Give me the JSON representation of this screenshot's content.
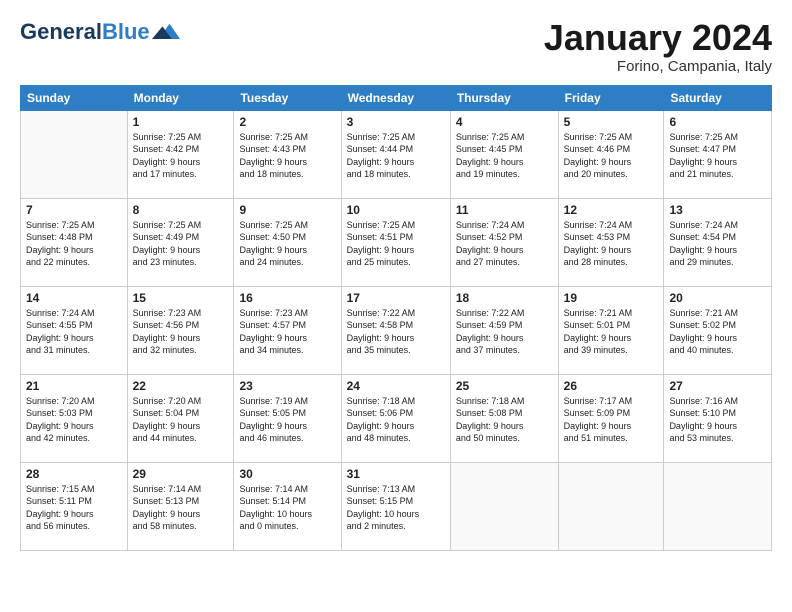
{
  "header": {
    "logo_line1": "General",
    "logo_line2": "Blue",
    "month_title": "January 2024",
    "location": "Forino, Campania, Italy"
  },
  "days_of_week": [
    "Sunday",
    "Monday",
    "Tuesday",
    "Wednesday",
    "Thursday",
    "Friday",
    "Saturday"
  ],
  "weeks": [
    [
      {
        "day": "",
        "info": ""
      },
      {
        "day": "1",
        "info": "Sunrise: 7:25 AM\nSunset: 4:42 PM\nDaylight: 9 hours\nand 17 minutes."
      },
      {
        "day": "2",
        "info": "Sunrise: 7:25 AM\nSunset: 4:43 PM\nDaylight: 9 hours\nand 18 minutes."
      },
      {
        "day": "3",
        "info": "Sunrise: 7:25 AM\nSunset: 4:44 PM\nDaylight: 9 hours\nand 18 minutes."
      },
      {
        "day": "4",
        "info": "Sunrise: 7:25 AM\nSunset: 4:45 PM\nDaylight: 9 hours\nand 19 minutes."
      },
      {
        "day": "5",
        "info": "Sunrise: 7:25 AM\nSunset: 4:46 PM\nDaylight: 9 hours\nand 20 minutes."
      },
      {
        "day": "6",
        "info": "Sunrise: 7:25 AM\nSunset: 4:47 PM\nDaylight: 9 hours\nand 21 minutes."
      }
    ],
    [
      {
        "day": "7",
        "info": "Sunrise: 7:25 AM\nSunset: 4:48 PM\nDaylight: 9 hours\nand 22 minutes."
      },
      {
        "day": "8",
        "info": "Sunrise: 7:25 AM\nSunset: 4:49 PM\nDaylight: 9 hours\nand 23 minutes."
      },
      {
        "day": "9",
        "info": "Sunrise: 7:25 AM\nSunset: 4:50 PM\nDaylight: 9 hours\nand 24 minutes."
      },
      {
        "day": "10",
        "info": "Sunrise: 7:25 AM\nSunset: 4:51 PM\nDaylight: 9 hours\nand 25 minutes."
      },
      {
        "day": "11",
        "info": "Sunrise: 7:24 AM\nSunset: 4:52 PM\nDaylight: 9 hours\nand 27 minutes."
      },
      {
        "day": "12",
        "info": "Sunrise: 7:24 AM\nSunset: 4:53 PM\nDaylight: 9 hours\nand 28 minutes."
      },
      {
        "day": "13",
        "info": "Sunrise: 7:24 AM\nSunset: 4:54 PM\nDaylight: 9 hours\nand 29 minutes."
      }
    ],
    [
      {
        "day": "14",
        "info": "Sunrise: 7:24 AM\nSunset: 4:55 PM\nDaylight: 9 hours\nand 31 minutes."
      },
      {
        "day": "15",
        "info": "Sunrise: 7:23 AM\nSunset: 4:56 PM\nDaylight: 9 hours\nand 32 minutes."
      },
      {
        "day": "16",
        "info": "Sunrise: 7:23 AM\nSunset: 4:57 PM\nDaylight: 9 hours\nand 34 minutes."
      },
      {
        "day": "17",
        "info": "Sunrise: 7:22 AM\nSunset: 4:58 PM\nDaylight: 9 hours\nand 35 minutes."
      },
      {
        "day": "18",
        "info": "Sunrise: 7:22 AM\nSunset: 4:59 PM\nDaylight: 9 hours\nand 37 minutes."
      },
      {
        "day": "19",
        "info": "Sunrise: 7:21 AM\nSunset: 5:01 PM\nDaylight: 9 hours\nand 39 minutes."
      },
      {
        "day": "20",
        "info": "Sunrise: 7:21 AM\nSunset: 5:02 PM\nDaylight: 9 hours\nand 40 minutes."
      }
    ],
    [
      {
        "day": "21",
        "info": "Sunrise: 7:20 AM\nSunset: 5:03 PM\nDaylight: 9 hours\nand 42 minutes."
      },
      {
        "day": "22",
        "info": "Sunrise: 7:20 AM\nSunset: 5:04 PM\nDaylight: 9 hours\nand 44 minutes."
      },
      {
        "day": "23",
        "info": "Sunrise: 7:19 AM\nSunset: 5:05 PM\nDaylight: 9 hours\nand 46 minutes."
      },
      {
        "day": "24",
        "info": "Sunrise: 7:18 AM\nSunset: 5:06 PM\nDaylight: 9 hours\nand 48 minutes."
      },
      {
        "day": "25",
        "info": "Sunrise: 7:18 AM\nSunset: 5:08 PM\nDaylight: 9 hours\nand 50 minutes."
      },
      {
        "day": "26",
        "info": "Sunrise: 7:17 AM\nSunset: 5:09 PM\nDaylight: 9 hours\nand 51 minutes."
      },
      {
        "day": "27",
        "info": "Sunrise: 7:16 AM\nSunset: 5:10 PM\nDaylight: 9 hours\nand 53 minutes."
      }
    ],
    [
      {
        "day": "28",
        "info": "Sunrise: 7:15 AM\nSunset: 5:11 PM\nDaylight: 9 hours\nand 56 minutes."
      },
      {
        "day": "29",
        "info": "Sunrise: 7:14 AM\nSunset: 5:13 PM\nDaylight: 9 hours\nand 58 minutes."
      },
      {
        "day": "30",
        "info": "Sunrise: 7:14 AM\nSunset: 5:14 PM\nDaylight: 10 hours\nand 0 minutes."
      },
      {
        "day": "31",
        "info": "Sunrise: 7:13 AM\nSunset: 5:15 PM\nDaylight: 10 hours\nand 2 minutes."
      },
      {
        "day": "",
        "info": ""
      },
      {
        "day": "",
        "info": ""
      },
      {
        "day": "",
        "info": ""
      }
    ]
  ]
}
